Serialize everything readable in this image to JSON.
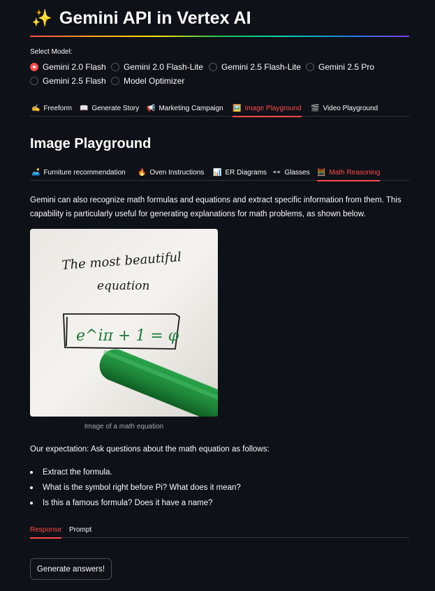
{
  "header": {
    "icon": "sparkles-icon",
    "title": "Gemini API in Vertex AI"
  },
  "model_select": {
    "label": "Select Model:",
    "selected": "Gemini 2.0 Flash",
    "options": [
      "Gemini 2.0 Flash",
      "Gemini 2.0 Flash-Lite",
      "Gemini 2.5 Flash-Lite",
      "Gemini 2.5 Pro",
      "Gemini 2.5 Flash",
      "Model Optimizer"
    ]
  },
  "main_tabs": [
    {
      "icon": "✍️",
      "label": "Freeform",
      "active": false
    },
    {
      "icon": "📖",
      "label": "Generate Story",
      "active": false
    },
    {
      "icon": "📢",
      "label": "Marketing Campaign",
      "active": false
    },
    {
      "icon": "🖼️",
      "label": "Image Playground",
      "active": true
    },
    {
      "icon": "🎬",
      "label": "Video Playground",
      "active": false
    }
  ],
  "section": {
    "heading": "Image Playground"
  },
  "sub_tabs": [
    {
      "icon": "🛋️",
      "label": "Furniture recommendation",
      "active": false
    },
    {
      "icon": "🔥",
      "label": "Oven Instructions",
      "active": false
    },
    {
      "icon": "📊",
      "label": "ER Diagrams",
      "active": false
    },
    {
      "icon": "👓",
      "label": "Glasses",
      "active": false
    },
    {
      "icon": "🧮",
      "label": "Math Reasoning",
      "active": true
    }
  ],
  "content": {
    "description": "Gemini can also recognize math formulas and equations and extract specific information from them. This capability is particularly useful for generating explanations for math problems, as shown below.",
    "image": {
      "handwritten_line1": "The most beautiful",
      "handwritten_line2": "equation",
      "formula": "e^iπ + 1 = φ",
      "caption": "Image of a math equation"
    },
    "expectation": "Our expectation: Ask questions about the math equation as follows:",
    "questions": [
      "Extract the formula.",
      "What is the symbol right before Pi? What does it mean?",
      "Is this a famous formula? Does it have a name?"
    ]
  },
  "result_tabs": [
    {
      "label": "Response",
      "active": true
    },
    {
      "label": "Prompt",
      "active": false
    }
  ],
  "actions": {
    "generate_label": "Generate answers!"
  },
  "colors": {
    "background": "#0e1117",
    "accent": "#ff4b4b",
    "text": "#fafafa",
    "muted": "#a3a8b4",
    "border": "#31333f",
    "pen_green": "#1f8a3b"
  }
}
